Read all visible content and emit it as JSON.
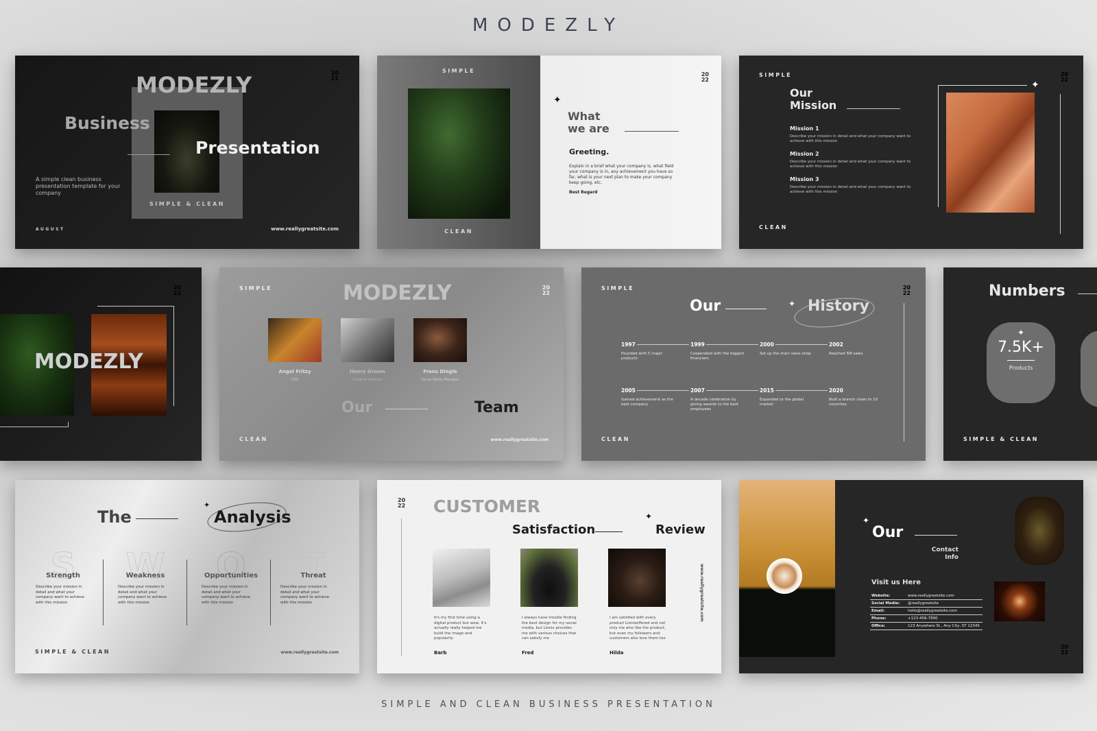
{
  "header": {
    "brand": "MODEZLY"
  },
  "footer": {
    "tagline": "SIMPLE AND CLEAN BUSINESS PRESENTATION"
  },
  "common": {
    "year_top": "20",
    "year_bottom": "22",
    "simple": "SIMPLE",
    "clean": "CLEAN",
    "simple_clean": "SIMPLE & CLEAN",
    "website": "www.reallygreatsite.com"
  },
  "slides": {
    "cover": {
      "brand": "MODEZLY",
      "word1": "Business",
      "word2": "Presentation",
      "subtitle": "A simple clean business presentation template for your company",
      "tag": "SIMPLE & CLEAN",
      "month": "AUGUST",
      "website": "www.reallygreatsite.com"
    },
    "greeting": {
      "top_label": "SIMPLE",
      "bottom_label": "CLEAN",
      "title_line1": "What",
      "title_line2": "we are",
      "heading": "Greeting.",
      "body": "Explain in a brief what your company is, what field your company is in, any achievement you have so far, what is your next plan to make your company keep going, etc.",
      "signoff": "Best Regard"
    },
    "mission": {
      "top_label": "SIMPLE",
      "bottom_label": "CLEAN",
      "title_line1": "Our",
      "title_line2": "Mission",
      "items": [
        {
          "title": "Mission 1",
          "desc": "Describe your mission in detail and what your company want to achieve with this mission"
        },
        {
          "title": "Mission 2",
          "desc": "Describe your mission in detail and what your company want to achieve with this mission"
        },
        {
          "title": "Mission 3",
          "desc": "Describe your mission in detail and what your company want to achieve with this mission"
        }
      ]
    },
    "brand_slide": {
      "brand": "MODEZLY"
    },
    "team": {
      "top_label": "SIMPLE",
      "bottom_label": "CLEAN",
      "brand": "MODEZLY",
      "title_word1": "Our",
      "title_word2": "Team",
      "website": "www.reallygreatsite.com",
      "members": [
        {
          "name": "Angel Fritzy",
          "role": "CEO"
        },
        {
          "name": "Henry Groom",
          "role": "Creative Director"
        },
        {
          "name": "Frans Dingle",
          "role": "Social Media Manager"
        }
      ]
    },
    "history": {
      "top_label": "SIMPLE",
      "bottom_label": "CLEAN",
      "title_word1": "Our",
      "title_word2": "History",
      "events": [
        {
          "year": "1997",
          "desc": "Founded with 5 major products"
        },
        {
          "year": "1999",
          "desc": "Cooperated with the biggest financiers"
        },
        {
          "year": "2000",
          "desc": "Set up the main sales shop"
        },
        {
          "year": "2002",
          "desc": "Reached 5M sales"
        },
        {
          "year": "2005",
          "desc": "Gained achievement as the best company"
        },
        {
          "year": "2007",
          "desc": "A decade celebration by giving awards to the best employees"
        },
        {
          "year": "2015",
          "desc": "Expanded to the global market"
        },
        {
          "year": "2020",
          "desc": "Built a branch chain to 10 countries"
        }
      ]
    },
    "numbers": {
      "title": "Numbers",
      "stat_value": "7.5K+",
      "stat_label": "Products",
      "bottom_label": "SIMPLE & CLEAN"
    },
    "swot": {
      "title_word1": "The",
      "title_word2": "Analysis",
      "bottom_label": "SIMPLE & CLEAN",
      "website": "www.reallygreatsite.com",
      "items": [
        {
          "letter": "S",
          "title": "Strength",
          "desc": "Describe your mission in detail and what your company want to achieve with this mission"
        },
        {
          "letter": "W",
          "title": "Weakness",
          "desc": "Describe your mission in detail and what your company want to achieve with this mission"
        },
        {
          "letter": "O",
          "title": "Opportunities",
          "desc": "Describe your mission in detail and what your company want to achieve with this mission"
        },
        {
          "letter": "T",
          "title": "Threat",
          "desc": "Describe your mission in detail and what your company want to achieve with this mission"
        }
      ]
    },
    "review": {
      "title_top": "CUSTOMER",
      "title_word1": "Satisfaction",
      "title_word2": "Review",
      "website": "www.reallygreatsite.com",
      "reviews": [
        {
          "name": "Barb",
          "text": "It's my first time using a digital product but wow, it's actually really helped me build the image and popularity"
        },
        {
          "name": "Fred",
          "text": "I always have trouble finding the best design for my social media, but Lionix provides me with various choices that can satisfy me"
        },
        {
          "name": "Hilda",
          "text": "I am satisfied with every product Lionixoffered and not only me who like the product, but even my followers and customers also love them too"
        }
      ]
    },
    "contact": {
      "title_word1": "Our",
      "title_sub1": "Contact",
      "title_sub2": "Info",
      "visit": "Visit us Here",
      "rows": [
        {
          "label": "Website:",
          "value": "www.reallygreatsite.com"
        },
        {
          "label": "Social Media:",
          "value": "@reallygreatsite"
        },
        {
          "label": "Email:",
          "value": "hello@reallygreatsite.com"
        },
        {
          "label": "Phone:",
          "value": "+123-456-7890"
        },
        {
          "label": "Office:",
          "value": "123 Anywhere St., Any City, ST 12345"
        }
      ]
    }
  }
}
